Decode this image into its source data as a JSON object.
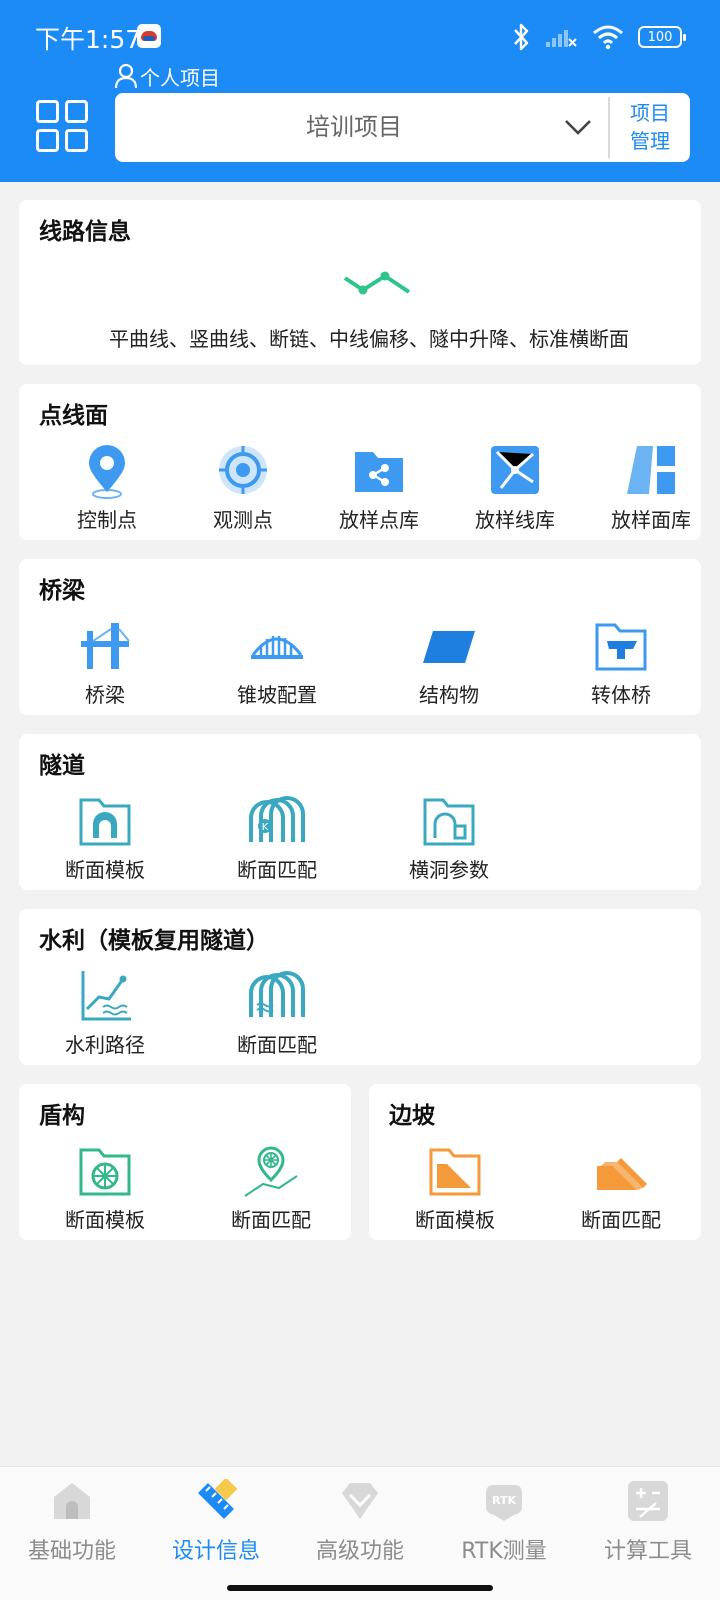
{
  "status_bar": {
    "time": "下午1:57",
    "battery": "100"
  },
  "header": {
    "personal_label": "个人项目",
    "project_name": "培训项目",
    "manage_line1": "项目",
    "manage_line2": "管理"
  },
  "sections": {
    "route": {
      "title": "线路信息",
      "description": "平曲线、竖曲线、断链、中线偏移、隧中升降、标准横断面"
    },
    "point_line_plane": {
      "title": "点线面",
      "items": [
        "控制点",
        "观测点",
        "放样点库",
        "放样线库",
        "放样面库"
      ]
    },
    "bridge": {
      "title": "桥梁",
      "items": [
        "桥梁",
        "锥坡配置",
        "结构物",
        "转体桥"
      ]
    },
    "tunnel": {
      "title": "隧道",
      "items": [
        "断面模板",
        "断面匹配",
        "横洞参数"
      ]
    },
    "water": {
      "title": "水利（模板复用隧道）",
      "items": [
        "水利路径",
        "断面匹配"
      ]
    },
    "shield": {
      "title": "盾构",
      "items": [
        "断面模板",
        "断面匹配"
      ]
    },
    "slope": {
      "title": "边坡",
      "items": [
        "断面模板",
        "断面匹配"
      ]
    }
  },
  "bottom_nav": {
    "items": [
      "基础功能",
      "设计信息",
      "高级功能",
      "RTK测量",
      "计算工具"
    ],
    "active_index": 1
  },
  "colors": {
    "primary": "#1d8bf5",
    "route_green": "#2ec48a",
    "tunnel_teal": "#3aa8c0",
    "shield_green": "#33b88a",
    "slope_orange": "#f49a3a"
  }
}
